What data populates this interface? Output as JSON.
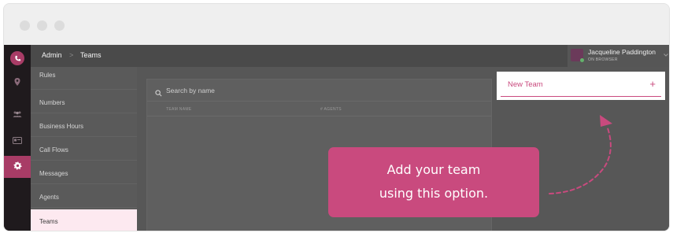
{
  "window": {
    "traffic_lights": [
      "close",
      "minimize",
      "maximize"
    ]
  },
  "rail": {
    "items": [
      {
        "icon": "phone-logo-icon"
      },
      {
        "icon": "pin-icon"
      },
      {
        "icon": "team-icon"
      },
      {
        "icon": "card-icon"
      },
      {
        "icon": "gear-icon",
        "active": true
      }
    ]
  },
  "breadcrumb": {
    "root": "Admin",
    "separator": ">",
    "current": "Teams"
  },
  "user": {
    "name": "Jacqueline Paddington",
    "status": "ON BROWSER"
  },
  "submenu": {
    "items": [
      {
        "label": "Rules"
      },
      {
        "label": "Numbers"
      },
      {
        "label": "Business Hours"
      },
      {
        "label": "Call Flows"
      },
      {
        "label": "Messages"
      },
      {
        "label": "Agents"
      },
      {
        "label": "Teams",
        "active": true
      }
    ]
  },
  "search": {
    "placeholder": "Search by name",
    "value": ""
  },
  "table": {
    "columns": [
      "TEAM NAME",
      "# AGENTS"
    ]
  },
  "new_team": {
    "label": "New Team",
    "add_symbol": "+"
  },
  "callout": {
    "line1": "Add your team",
    "line2": "using this option."
  },
  "colors": {
    "accent": "#c94a7e",
    "rail": "#1f1a1d",
    "highlight": "#fde9f0"
  }
}
